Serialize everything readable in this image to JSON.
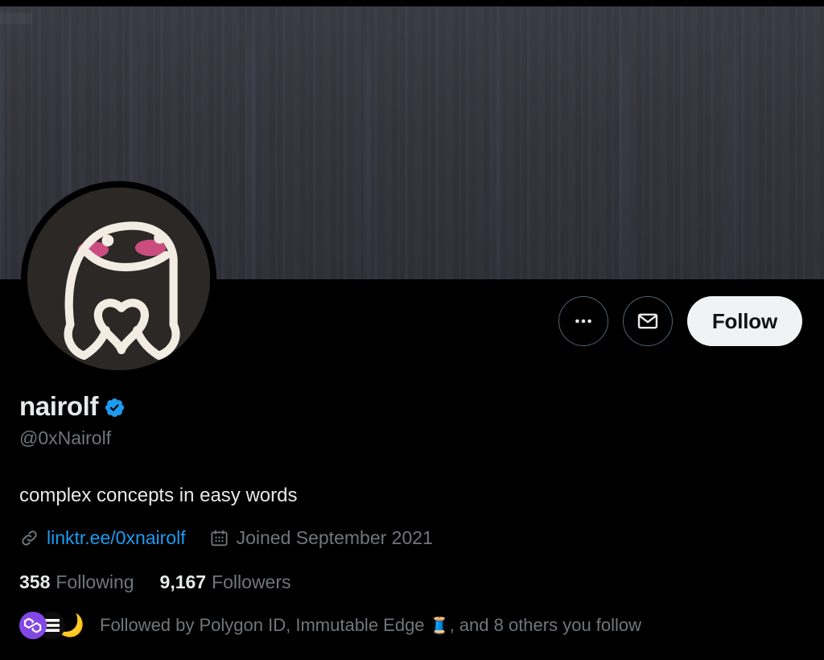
{
  "banner": {
    "name": "profile-banner",
    "color": "#34353d"
  },
  "avatar": {
    "alt": "nairolf profile photo",
    "background": "#2b2826",
    "line_color": "#f2ece2",
    "blush_color": "#e8538f"
  },
  "actions": {
    "more_label": "More",
    "message_label": "Message",
    "follow_label": "Follow",
    "follow_bg": "#eff3f4",
    "follow_fg": "#0f1419"
  },
  "identity": {
    "display_name": "nairolf",
    "handle": "@0xNairolf",
    "verified": true,
    "verified_color": "#1d9bf0"
  },
  "bio": {
    "text": "complex concepts in easy words"
  },
  "meta": {
    "link_icon": "link-icon",
    "link_text": "linktr.ee/0xnairolf",
    "link_color": "#1d9bf0",
    "calendar_icon": "calendar-icon",
    "joined_text": "Joined September 2021"
  },
  "stats": {
    "following_count": "358",
    "following_label": "Following",
    "followers_count": "9,167",
    "followers_label": "Followers"
  },
  "followed_by": {
    "prefix": "Followed by Polygon ID, Immutable Edge ",
    "emoji": "🧵",
    "suffix": ", and 8 others you follow",
    "faces": [
      {
        "name": "polygon-id-avatar",
        "color": "#8247e5"
      },
      {
        "name": "immutable-edge-avatar",
        "color": "#0d0d0d"
      },
      {
        "name": "moon-avatar",
        "color": "#000000",
        "glyph": "🌙"
      }
    ]
  }
}
